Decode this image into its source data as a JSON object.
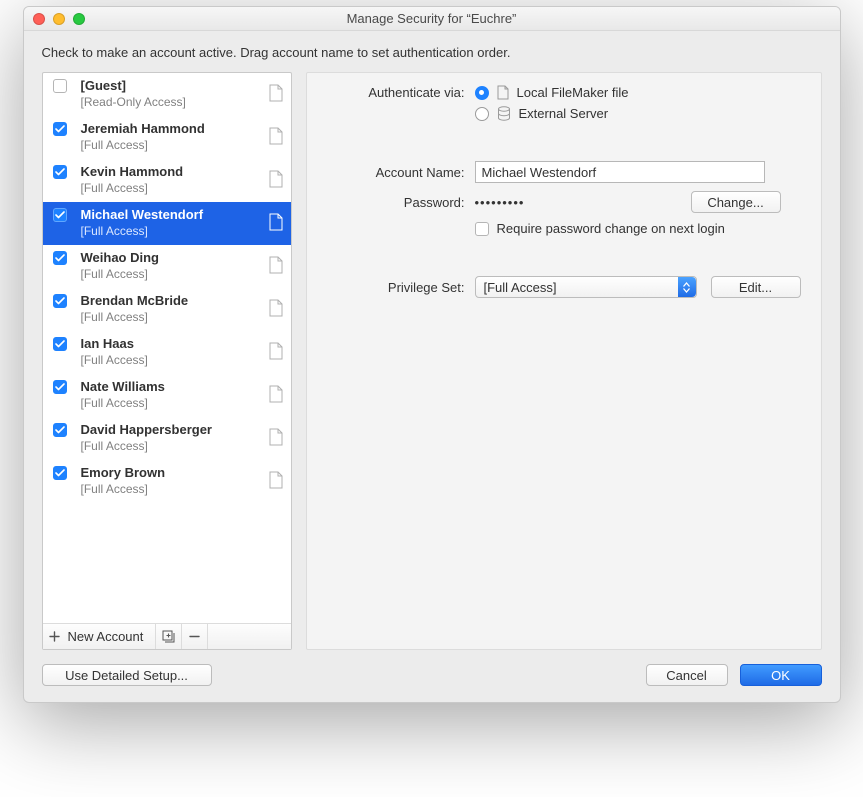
{
  "window": {
    "title": "Manage Security for “Euchre”"
  },
  "hint": "Check to make an account active.  Drag account name to set authentication order.",
  "accounts": [
    {
      "name": "[Guest]",
      "priv": "[Read-Only Access]",
      "checked": false,
      "selected": false
    },
    {
      "name": "Jeremiah Hammond",
      "priv": "[Full Access]",
      "checked": true,
      "selected": false
    },
    {
      "name": "Kevin Hammond",
      "priv": "[Full Access]",
      "checked": true,
      "selected": false
    },
    {
      "name": "Michael Westendorf",
      "priv": "[Full Access]",
      "checked": true,
      "selected": true
    },
    {
      "name": "Weihao Ding",
      "priv": "[Full Access]",
      "checked": true,
      "selected": false
    },
    {
      "name": "Brendan McBride",
      "priv": "[Full Access]",
      "checked": true,
      "selected": false
    },
    {
      "name": "Ian Haas",
      "priv": "[Full Access]",
      "checked": true,
      "selected": false
    },
    {
      "name": "Nate Williams",
      "priv": "[Full Access]",
      "checked": true,
      "selected": false
    },
    {
      "name": "David Happersberger",
      "priv": "[Full Access]",
      "checked": true,
      "selected": false
    },
    {
      "name": "Emory Brown",
      "priv": "[Full Access]",
      "checked": true,
      "selected": false
    }
  ],
  "leftFooter": {
    "new_label": "New Account"
  },
  "form": {
    "auth_label": "Authenticate via:",
    "auth_local": "Local FileMaker file",
    "auth_external": "External Server",
    "account_label": "Account Name:",
    "account_value": "Michael Westendorf",
    "password_label": "Password:",
    "password_mask": "•••••••••",
    "change_btn": "Change...",
    "require_label": "Require password change on next login",
    "priv_label": "Privilege Set:",
    "priv_value": "[Full Access]",
    "edit_btn": "Edit..."
  },
  "buttons": {
    "detailed": "Use Detailed Setup...",
    "cancel": "Cancel",
    "ok": "OK"
  }
}
